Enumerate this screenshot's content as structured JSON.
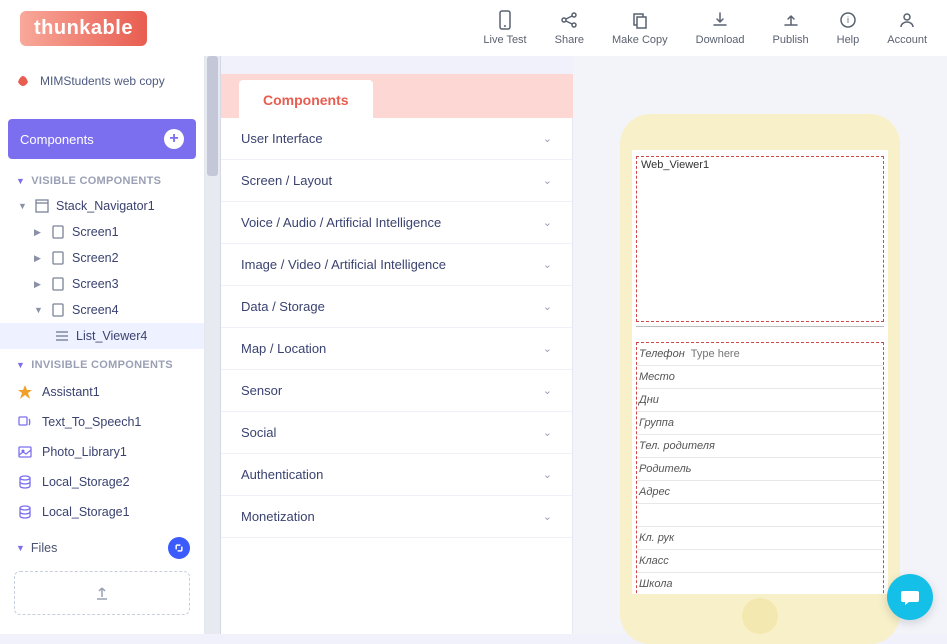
{
  "logo_text": "thunkable",
  "header": {
    "live_test": "Live Test",
    "share": "Share",
    "make_copy": "Make Copy",
    "download": "Download",
    "publish": "Publish",
    "help": "Help",
    "account": "Account"
  },
  "project_name": "MIMStudents web copy",
  "components_header": "Components",
  "sections": {
    "visible": "VISIBLE COMPONENTS",
    "invisible": "INVISIBLE COMPONENTS"
  },
  "tree": {
    "stack_nav": "Stack_Navigator1",
    "screen1": "Screen1",
    "screen2": "Screen2",
    "screen3": "Screen3",
    "screen4": "Screen4",
    "list_viewer4": "List_Viewer4"
  },
  "invisible": {
    "assistant": "Assistant1",
    "tts": "Text_To_Speech1",
    "photo": "Photo_Library1",
    "storage2": "Local_Storage2",
    "storage1": "Local_Storage1"
  },
  "files_label": "Files",
  "tab_components": "Components",
  "categories": [
    "User Interface",
    "Screen / Layout",
    "Voice / Audio / Artificial Intelligence",
    "Image / Video / Artificial Intelligence",
    "Data / Storage",
    "Map / Location",
    "Sensor",
    "Social",
    "Authentication",
    "Monetization"
  ],
  "preview": {
    "webviewer_label": "Web_Viewer1",
    "phone_label": "Телефон",
    "phone_placeholder": "Type here",
    "rows": [
      "Место",
      "Дни",
      "Группа",
      "Тел. родителя",
      "Родитель",
      "Адрес",
      "",
      "Кл. рук",
      "Класс",
      "Школа"
    ]
  }
}
